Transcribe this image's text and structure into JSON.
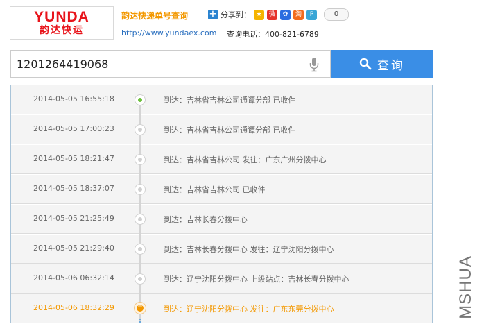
{
  "header": {
    "logo_en": "YUNDA",
    "logo_cn": "韵达快运",
    "title": "韵达快递单号查询",
    "share_label": "分享到：",
    "share_count": "0",
    "url": "http://www.yundaex.com",
    "phone": "查询电话：400-821-6789"
  },
  "search": {
    "value": "1201264419068",
    "button_label": "查询"
  },
  "timeline": [
    {
      "time": "2014-05-05 16:55:18",
      "desc": "到达：吉林省吉林公司通谭分部 已收件"
    },
    {
      "time": "2014-05-05 17:00:23",
      "desc": "到达：吉林省吉林公司通谭分部 已收件"
    },
    {
      "time": "2014-05-05 18:21:47",
      "desc": "到达：吉林省吉林公司 发往：广东广州分拨中心"
    },
    {
      "time": "2014-05-05 18:37:07",
      "desc": "到达：吉林省吉林公司 已收件"
    },
    {
      "time": "2014-05-05 21:25:49",
      "desc": "到达：吉林长春分拨中心"
    },
    {
      "time": "2014-05-05 21:29:40",
      "desc": "到达：吉林长春分拨中心 发往：辽宁沈阳分拨中心"
    },
    {
      "time": "2014-05-06 06:32:14",
      "desc": "到达：辽宁沈阳分拨中心 上级站点：吉林长春分拨中心"
    },
    {
      "time": "2014-05-06 18:32:29",
      "desc": "到达：辽宁沈阳分拨中心 发往：广东东莞分拨中心"
    }
  ],
  "watermark": "MSHUA",
  "colors": {
    "brand": "#e8141b",
    "accent": "#f39800",
    "button": "#3a8ee6"
  }
}
